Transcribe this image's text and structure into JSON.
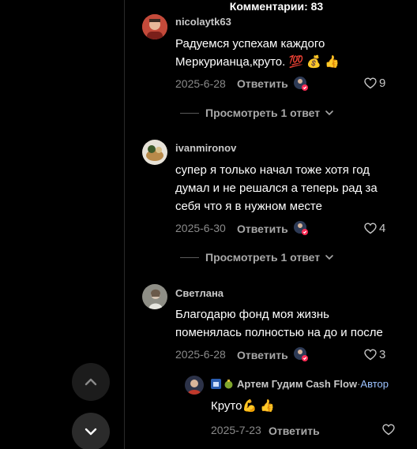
{
  "header": {
    "title": "Комментарии: 83"
  },
  "comments": [
    {
      "username": "nicolaytk63",
      "text_line1": "Радуемся успехам каждого",
      "text_line2": "Меркурианца,круто. 💯 💰 👍",
      "date": "2025-6-28",
      "reply_label": "Ответить",
      "likes": "9",
      "view_replies": "Просмотреть 1 ответ"
    },
    {
      "username": "ivanmironov",
      "text_line1": "супер я только начал тоже хотя год",
      "text_line2": "думал и не решался а теперь рад за",
      "text_line3": "себя что я в нужном месте",
      "date": "2025-6-30",
      "reply_label": "Ответить",
      "likes": "4",
      "view_replies": "Просмотреть 1 ответ"
    },
    {
      "username": "Светлана",
      "text_line1": "Благодарю фонд моя жизнь",
      "text_line2": "поменялась полностью на до и после",
      "date": "2025-6-28",
      "reply_label": "Ответить",
      "likes": "3"
    }
  ],
  "reply": {
    "username": "Артем Гудим Cash Flow",
    "author_sep": " · ",
    "author_label": "Автор",
    "text": "Круто💪 👍",
    "date": "2025-7-23",
    "reply_label": "Ответить"
  },
  "icons": {
    "nav_up": "chevron-up-icon",
    "nav_down": "chevron-down-icon",
    "like": "heart-icon",
    "creator_avatar": "creator-avatar-icon"
  },
  "colors": {
    "background": "#000000",
    "text_secondary": "#8a8a8a",
    "author_accent": "#9cc2ff"
  }
}
